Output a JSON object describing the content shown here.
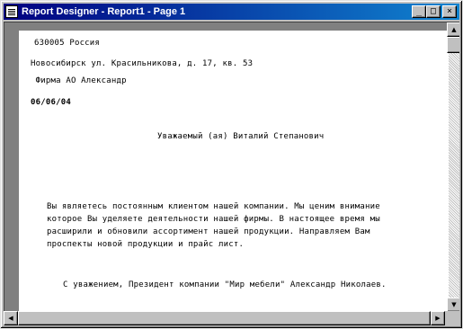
{
  "window": {
    "title": "Report Designer - Report1 - Page 1"
  },
  "report": {
    "lines": [
      "630005 Россия",
      "Новосибирск ул. Красильникова, д. 17, кв. 53",
      " Фирма АО Александр",
      "06/06/04",
      "Уважаемый (ая) Виталий Степанович",
      "Вы являетесь постоянным клиентом нашей компании. Мы ценим внимание",
      "которое Вы уделяете деятельности нашей фирмы. В настоящее время мы",
      "расширили и обновили ассортимент нашей продукции. Направляем Вам",
      "проспекты новой продукции и прайс лист.",
      "С уважением, Президент компании \"Мир мебели\" Александр Николаев."
    ]
  },
  "controls": {
    "minimize": "_",
    "maximize": "□",
    "close": "×",
    "arrow_up": "▲",
    "arrow_down": "▼",
    "arrow_left": "◀",
    "arrow_right": "▶"
  },
  "colors": {
    "title_start": "#000080",
    "title_end": "#1084d0",
    "workspace": "#808080",
    "page": "#ffffff"
  },
  "icons": [
    "report-icon"
  ]
}
